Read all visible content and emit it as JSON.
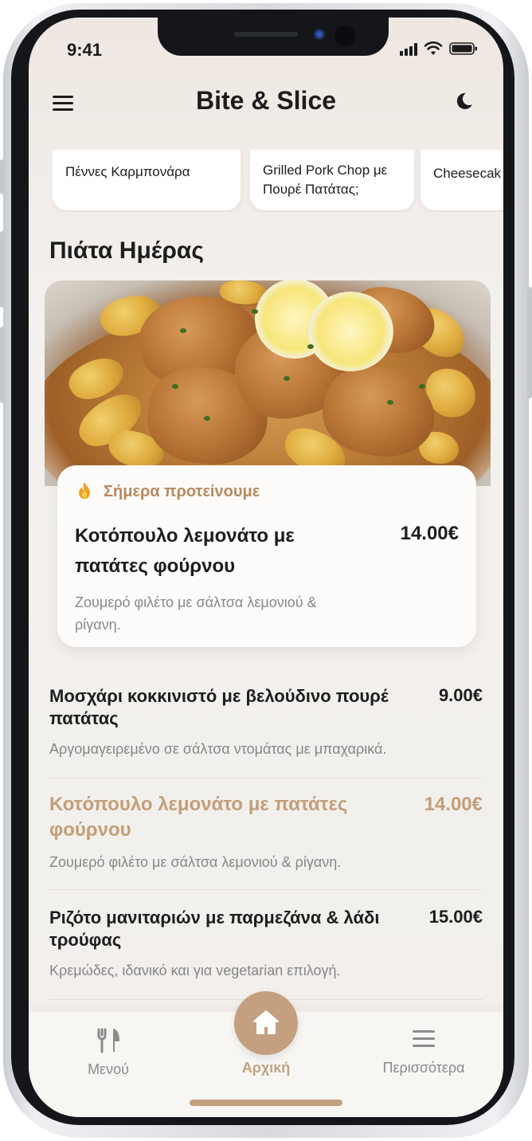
{
  "status_bar": {
    "time": "9:41"
  },
  "header": {
    "title": "Bite & Slice"
  },
  "quick_items": [
    {
      "label": "Πέννες Καρμπονάρα"
    },
    {
      "label": "Grilled Pork Chop με Πουρέ Πατάτας;"
    },
    {
      "label": "Cheesecak"
    }
  ],
  "section": {
    "title": "Πιάτα Ημέρας"
  },
  "featured": {
    "tag": "Σήμερα προτείνουμε",
    "name": "Κοτόπουλο λεμονάτο με πατάτες φούρνου",
    "price": "14.00€",
    "description": "Ζουμερό φιλέτο με σάλτσα λεμονιού & ρίγανη."
  },
  "menu_items": [
    {
      "name": "Μοσχάρι κοκκινιστό με βελούδινο πουρέ πατάτας",
      "price": "9.00€",
      "description": "Αργομαγειρεμένο σε σάλτσα ντομάτας με μπαχαρικά."
    },
    {
      "name": "Κοτόπουλο λεμονάτο με πατάτες φούρνου",
      "price": "14.00€",
      "description": "Ζουμερό φιλέτο με σάλτσα λεμονιού & ρίγανη."
    },
    {
      "name": "Ριζότο μανιταριών με παρμεζάνα & λάδι τρούφας",
      "price": "15.00€",
      "description": "Κρεμώδες, ιδανικό και για vegetarian επιλογή."
    }
  ],
  "nav": {
    "menu_label": "Μενού",
    "home_label": "Αρχική",
    "more_label": "Περισσότερα"
  },
  "colors": {
    "accent": "#c4a080",
    "text": "#1d1d1f",
    "muted": "#878688"
  }
}
